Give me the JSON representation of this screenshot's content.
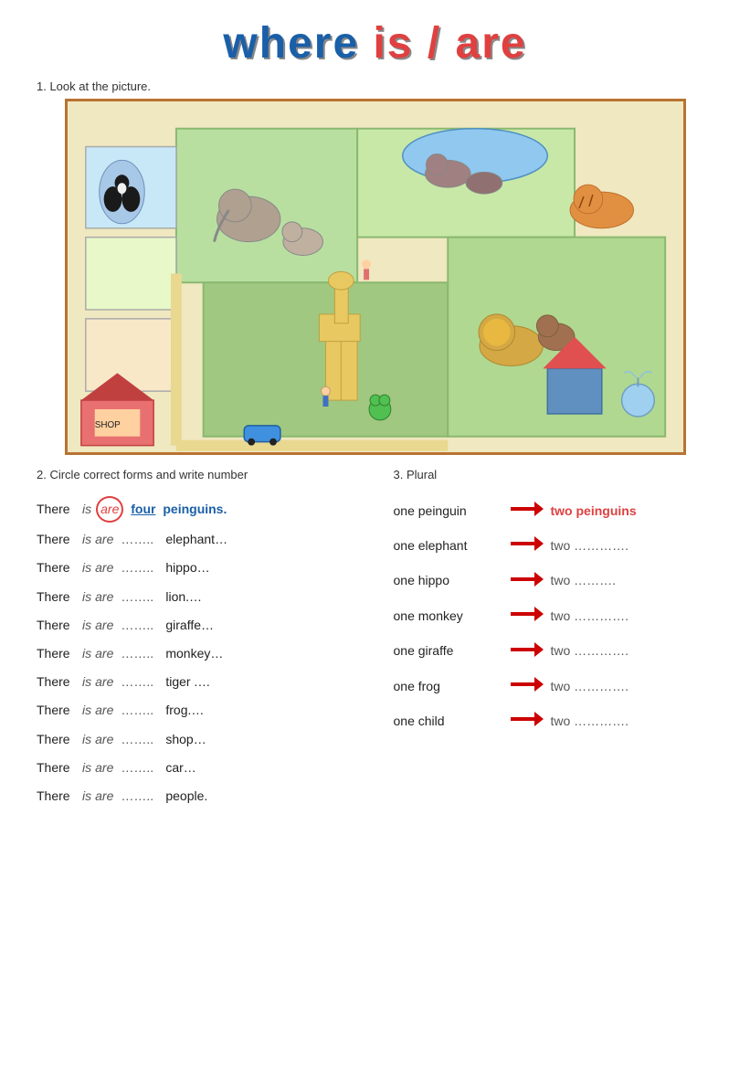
{
  "title": {
    "part1": "where ",
    "part2": "is / are"
  },
  "instruction1": "1. Look at the picture.",
  "instruction2": "2. Circle correct forms and write number",
  "instruction3": "3. Plural",
  "exercise_rows": [
    {
      "there": "There",
      "is": "is",
      "are": "are",
      "are_circled": true,
      "number": "four",
      "number_style": "underline_blue",
      "dots": "",
      "animal": "peinguins.",
      "animal_style": "blue_bold"
    },
    {
      "there": "There",
      "is": "is",
      "are": "are",
      "are_circled": false,
      "number": "……..",
      "dots": "",
      "animal": "elephant…",
      "animal_style": "normal"
    },
    {
      "there": "There",
      "is": "is",
      "are": "are",
      "are_circled": false,
      "number": "……..",
      "dots": "",
      "animal": "hippo…",
      "animal_style": "normal"
    },
    {
      "there": "There",
      "is": "is",
      "are": "are",
      "are_circled": false,
      "number": "…….",
      "dots": "",
      "animal": "lion.…",
      "animal_style": "normal"
    },
    {
      "there": "There",
      "is": "is",
      "are": "are",
      "are_circled": false,
      "number": "…….",
      "dots": "",
      "animal": "giraffe…",
      "animal_style": "normal"
    },
    {
      "there": "There",
      "is": "is",
      "are": "are",
      "are_circled": false,
      "number": "…….",
      "dots": "",
      "animal": "monkey…",
      "animal_style": "normal"
    },
    {
      "there": "There",
      "is": "is",
      "are": "are",
      "are_circled": false,
      "number": "…….",
      "dots": "",
      "animal": "tiger .…",
      "animal_style": "normal"
    },
    {
      "there": "There",
      "is": "is",
      "are": "are",
      "are_circled": false,
      "number": "…….",
      "dots": "",
      "animal": "frog.…",
      "animal_style": "normal"
    },
    {
      "there": "There",
      "is": "is",
      "are": "are",
      "are_circled": false,
      "number": "…….",
      "dots": "",
      "animal": "shop…",
      "animal_style": "normal"
    },
    {
      "there": "There",
      "is": "is",
      "are": "are",
      "are_circled": false,
      "number": "…….",
      "dots": "",
      "animal": "car…",
      "animal_style": "normal"
    },
    {
      "there": "There",
      "is": "is",
      "are": "are",
      "are_circled": false,
      "number": "…….",
      "dots": "",
      "animal": "people.",
      "animal_style": "normal"
    }
  ],
  "plural_rows": [
    {
      "one": "one peinguin",
      "two_label": "two peinguins",
      "two_style": "answer"
    },
    {
      "one": "one elephant",
      "two_label": "two ………….",
      "two_style": "dots"
    },
    {
      "one": "one hippo",
      "two_label": "two ……….",
      "two_style": "dots"
    },
    {
      "one": "one monkey",
      "two_label": "two ………….",
      "two_style": "dots"
    },
    {
      "one": "one giraffe",
      "two_label": "two ………….",
      "two_style": "dots"
    },
    {
      "one": "one frog",
      "two_label": "two ………….",
      "two_style": "dots"
    },
    {
      "one": "one child",
      "two_label": "two ………….",
      "two_style": "dots"
    }
  ]
}
